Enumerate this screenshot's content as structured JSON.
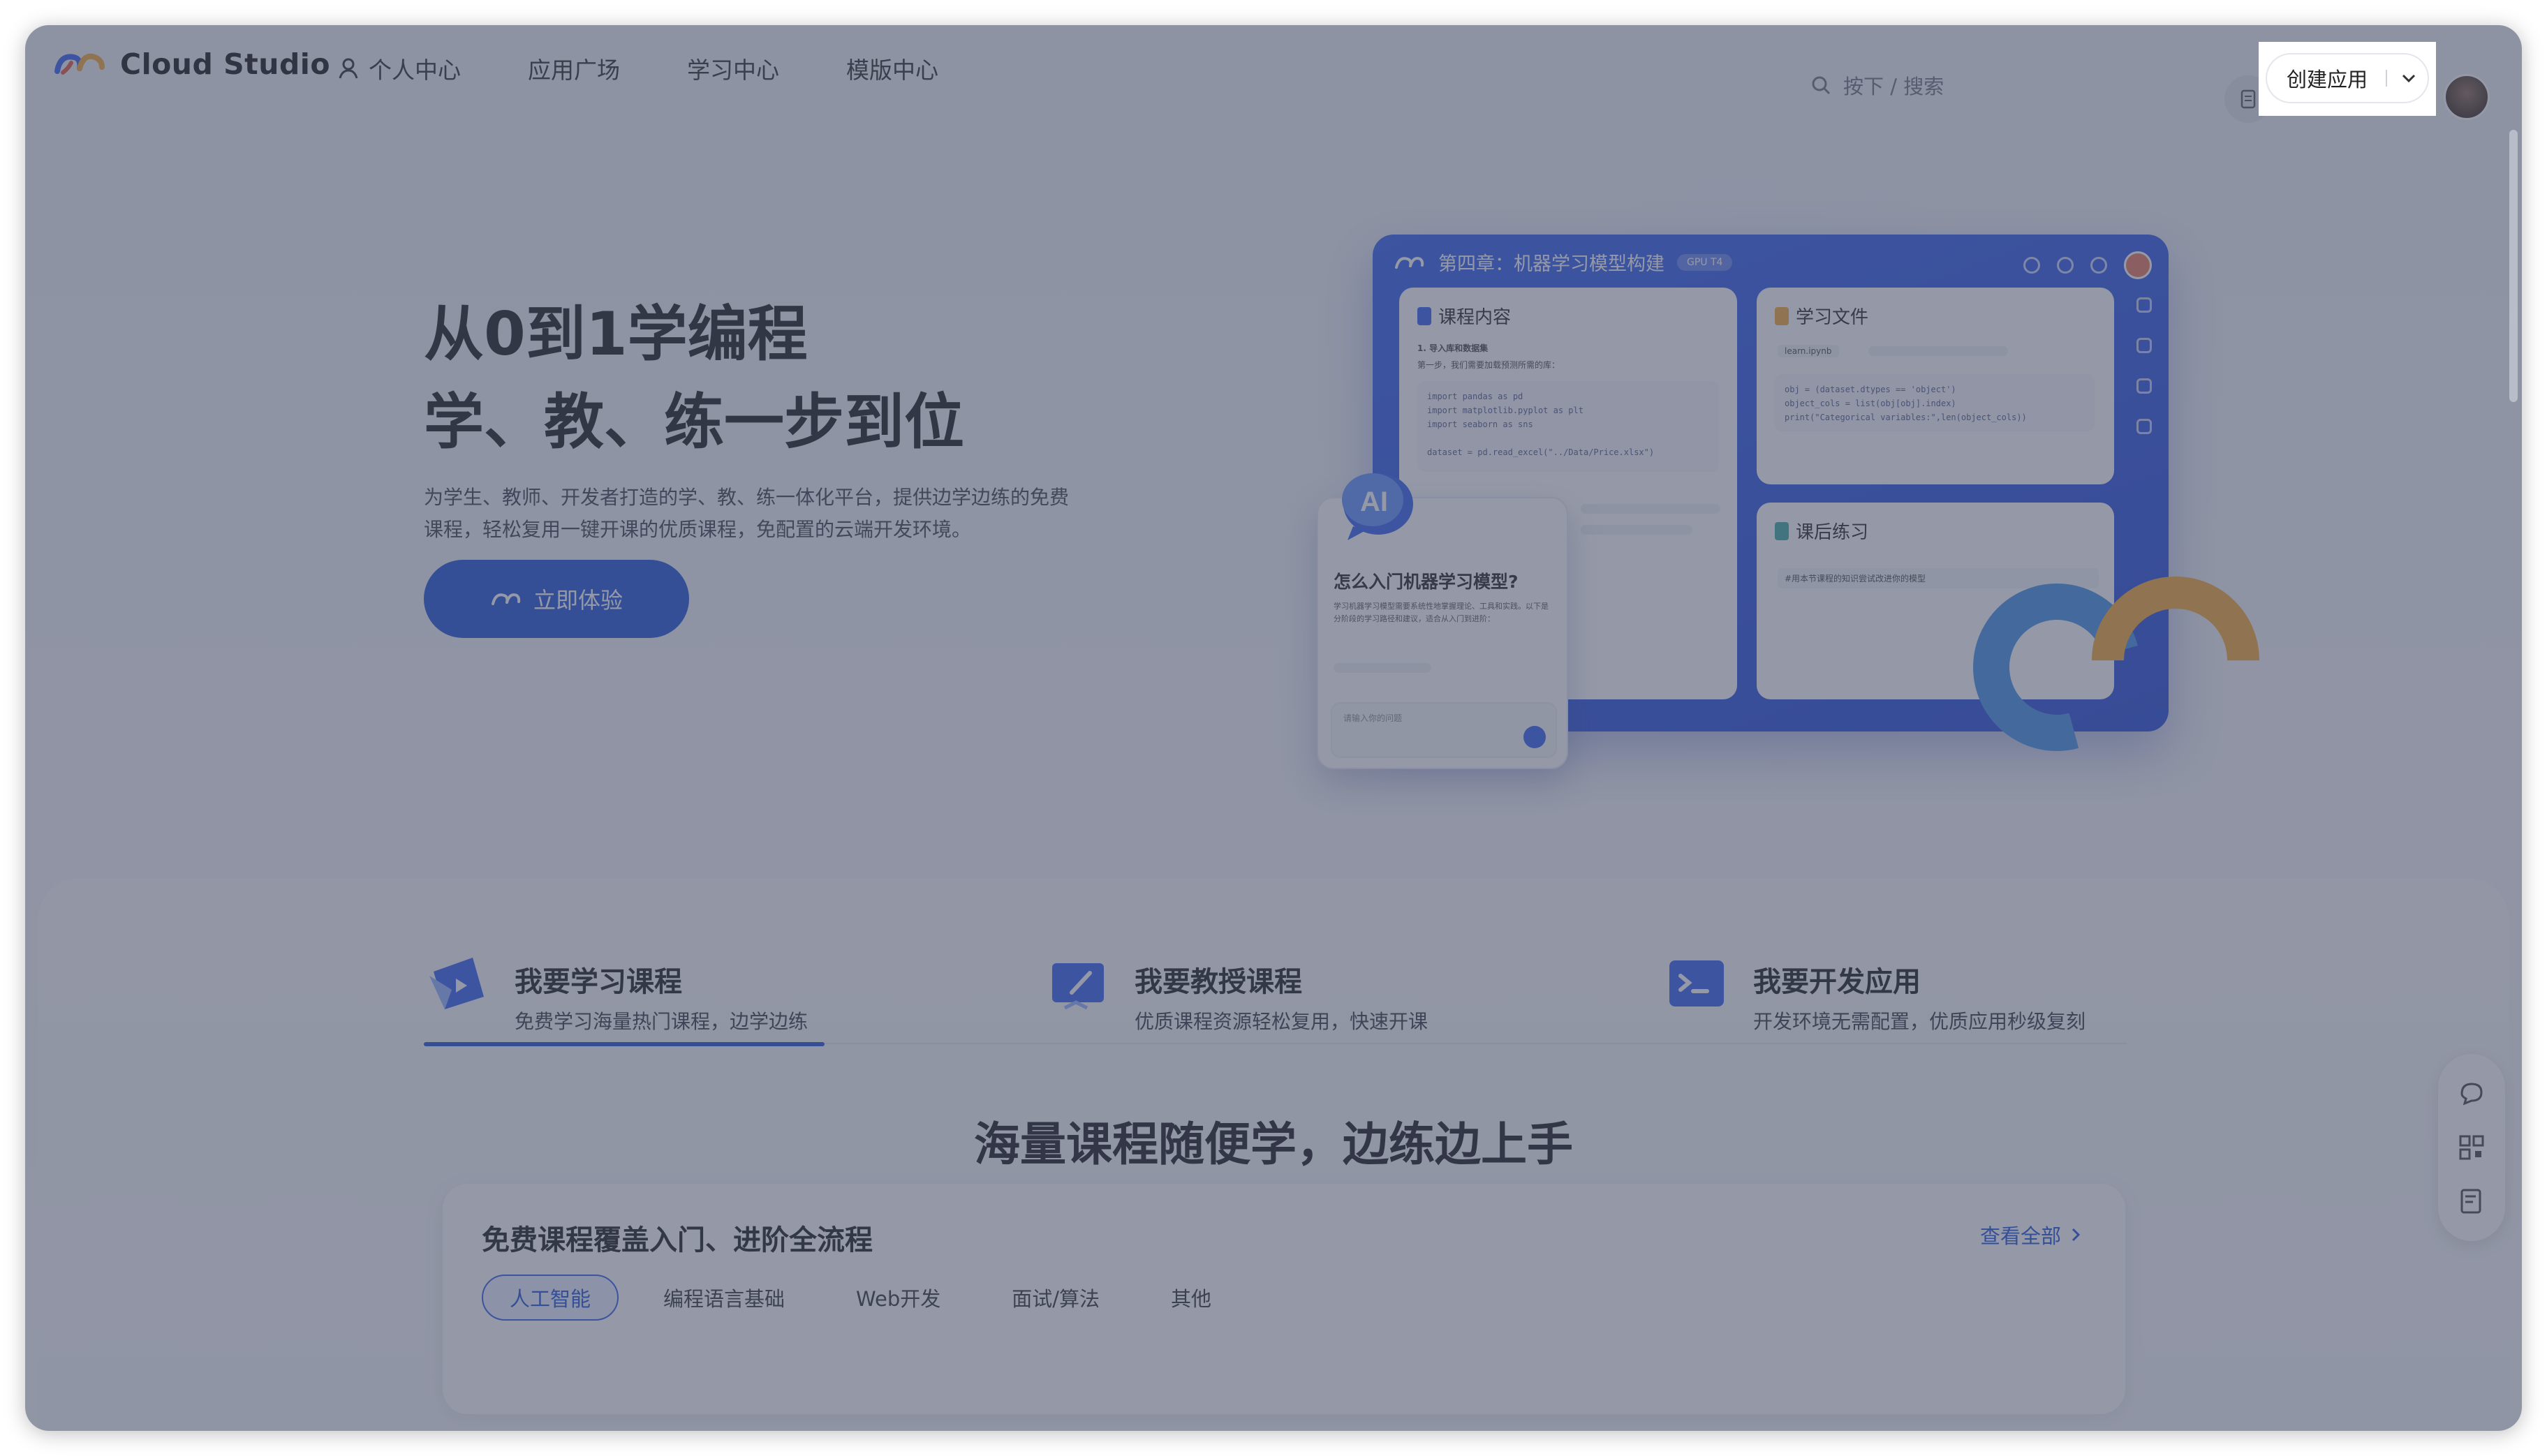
{
  "app": {
    "name": "Cloud Studio"
  },
  "nav": {
    "items": [
      "个人中心",
      "应用广场",
      "学习中心",
      "模版中心"
    ]
  },
  "search": {
    "hint": "按下 /  搜索"
  },
  "header": {
    "create_label": "创建应用"
  },
  "hero": {
    "title_line1": "从0到1学编程",
    "title_line2": "学、教、练一步到位",
    "desc": "为学生、教师、开发者打造的学、教、练一体化平台，提供边学边练的免费课程，轻松复用一键开课的优质课程，免配置的云端开发环境。",
    "cta": "立即体验"
  },
  "illustration": {
    "ide_title": "第四章：机器学习模型构建",
    "gpu_badge": "GPU T4",
    "panel_course": "课程内容",
    "course_step": "1. 导入库和数据集",
    "course_line": "第一步，我们需要加载预测所需的库：",
    "code1": "import pandas as pd\nimport matplotlib.pyplot as plt\nimport seaborn as sns\n\ndataset = pd.read_excel(\"../Data/Price.xlsx\")",
    "panel_files": "学习文件",
    "file_name": "learn.ipynb",
    "code2": "obj = (dataset.dtypes == 'object')\nobject_cols = list(obj[obj].index)\nprint(\"Categorical variables:\",len(object_cols))",
    "panel_practice": "课后练习",
    "practice_line": "#用本节课程的知识尝试改进你的模型",
    "chat_badge": "AI",
    "chat_question": "怎么入门机器学习模型?",
    "chat_answer": "学习机器学习模型需要系统性地掌握理论、工具和实践。以下是分阶段的学习路径和建议，适合从入门到进阶：",
    "chat_placeholder": "请输入你的问题"
  },
  "tabs": [
    {
      "title": "我要学习课程",
      "sub": "免费学习海量热门课程，边学边练"
    },
    {
      "title": "我要教授课程",
      "sub": "优质课程资源轻松复用，快速开课"
    },
    {
      "title": "我要开发应用",
      "sub": "开发环境无需配置，优质应用秒级复刻"
    }
  ],
  "section": {
    "title": "海量课程随便学，边练边上手"
  },
  "courses": {
    "title": "免费课程覆盖入门、进阶全流程",
    "see_all": "查看全部",
    "chips": [
      "人工智能",
      "编程语言基础",
      "Web开发",
      "面试/算法",
      "其他"
    ]
  },
  "colors": {
    "brand": "#1c4fd8",
    "accent_orange": "#f2a531",
    "overlay": "#485068"
  },
  "icons": [
    "user-icon",
    "search-icon",
    "doc-icon",
    "chevron-down-icon",
    "chat-icon",
    "qrcode-icon",
    "feedback-icon"
  ]
}
